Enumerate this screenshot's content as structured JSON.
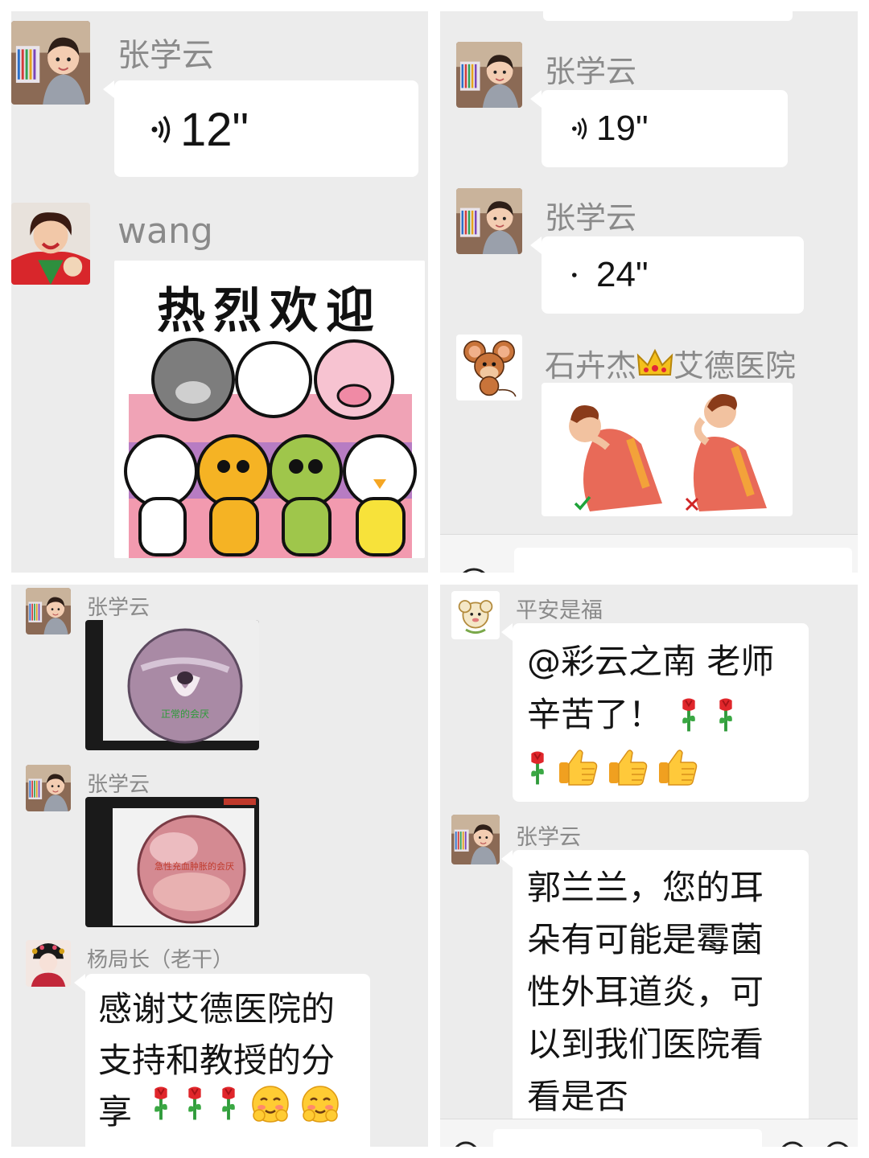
{
  "panel1": {
    "m1": {
      "sender": "张学云",
      "voice_duration": "12\""
    },
    "m2": {
      "sender": "wang",
      "sticker_text": "热烈欢迎"
    }
  },
  "panel2": {
    "m1": {
      "sender": "张学云",
      "voice_duration": "19\""
    },
    "m2": {
      "sender": "张学云",
      "voice_duration": "24\""
    },
    "m3": {
      "sender_pre": "石卉杰",
      "sender_post": "艾德医院"
    }
  },
  "panel3": {
    "m1": {
      "sender": "张学云",
      "image_caption": "正常的会厌"
    },
    "m2": {
      "sender": "张学云",
      "image_caption": "急性充血肿胀的会厌"
    },
    "m3": {
      "sender": "杨局长（老干）",
      "text": "感谢艾德医院的\n支持和教授的分\n享"
    }
  },
  "panel4": {
    "m1": {
      "sender": "平安是福",
      "text_line1": "@彩云之南  老师",
      "text_line2": "辛苦了！"
    },
    "m2": {
      "sender": "张学云",
      "text": "郭兰兰，您的耳\n朵有可能是霉菌\n性外耳道炎，可\n以到我们医院看\n看是否"
    }
  },
  "colors": {
    "background": "#ececec",
    "bubble": "#ffffff",
    "name_text": "#8a8a8a",
    "message_text": "#141414"
  },
  "icons": [
    "voice-wave-icon",
    "rose-icon",
    "thumbs-up-icon",
    "blush-face-icon",
    "crown-icon",
    "check-icon",
    "cross-icon"
  ]
}
